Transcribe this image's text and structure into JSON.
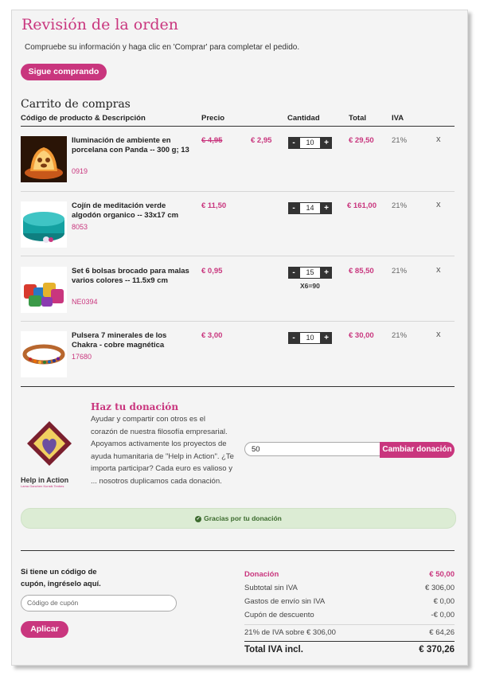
{
  "page": {
    "title": "Revisión de la orden",
    "subtitle": "Compruebe su información y haga clic en 'Comprar' para completar el pedido.",
    "continue_label": "Sigue comprando"
  },
  "cart": {
    "title": "Carrito de compras",
    "columns": {
      "product": "Código de producto & Descripción",
      "price": "Precio",
      "quantity": "Cantidad",
      "total": "Total",
      "iva": "IVA"
    },
    "items": [
      {
        "name": "Iluminación de ambiente en porcelana con Panda -- 300 g; 13",
        "code": "0919",
        "old_price": "€ 4,95",
        "price": "€ 2,95",
        "qty": "10",
        "total": "€ 29,50",
        "iva": "21%",
        "remove": "x"
      },
      {
        "name": "Cojín de meditación verde algodón organico -- 33x17 cm",
        "code": "8053",
        "price": "€ 11,50",
        "qty": "14",
        "total": "€ 161,00",
        "iva": "21%",
        "remove": "x"
      },
      {
        "name": "Set 6 bolsas brocado para malas varios colores -- 11.5x9 cm",
        "code": "NE0394",
        "price": "€ 0,95",
        "qty": "15",
        "qty_note": "X6=90",
        "total": "€ 85,50",
        "iva": "21%",
        "remove": "x"
      },
      {
        "name": "Pulsera 7 minerales de los Chakra - cobre magnética",
        "code": "17680",
        "price": "€ 3,00",
        "qty": "10",
        "total": "€ 30,00",
        "iva": "21%",
        "remove": "x"
      }
    ],
    "qty_minus": "-",
    "qty_plus": "+"
  },
  "donation": {
    "logo_text": "Help in Action",
    "logo_tagline": "Lama Ganchen Kunsik Tenbes",
    "title": "Haz tu donación",
    "text": "Ayudar y compartir con otros es el corazón de nuestra filosofía empresarial. Apoyamos activamente los proyectos de ayuda humanitaria de \"Help in Action\". ¿Te importa participar? Cada euro es valioso y ... nosotros duplicamos cada donación.",
    "amount": "50",
    "button": "Cambiar donación",
    "thanks": "Gracias por tu donación",
    "thanks_icon": "check-circle-icon"
  },
  "coupon": {
    "label": "Si tiene un código de cupón, ingréselo aquí.",
    "placeholder": "Código de cupón",
    "apply": "Aplicar"
  },
  "summary": {
    "donation_label": "Donación",
    "donation_value": "€ 50,00",
    "subtotal_label": "Subtotal sin IVA",
    "subtotal_value": "€ 306,00",
    "shipping_label": "Gastos de envío sin IVA",
    "shipping_value": "€ 0,00",
    "discount_label": "Cupón de descuento",
    "discount_value": "-€ 0,00",
    "tax_label": "21% de IVA sobre € 306,00",
    "tax_value": "€ 64,26",
    "total_label": "Total IVA incl.",
    "total_value": "€ 370,26"
  },
  "colors": {
    "accent": "#c9367e",
    "success_bg": "#dcecd4",
    "success_text": "#3c6b2e"
  }
}
